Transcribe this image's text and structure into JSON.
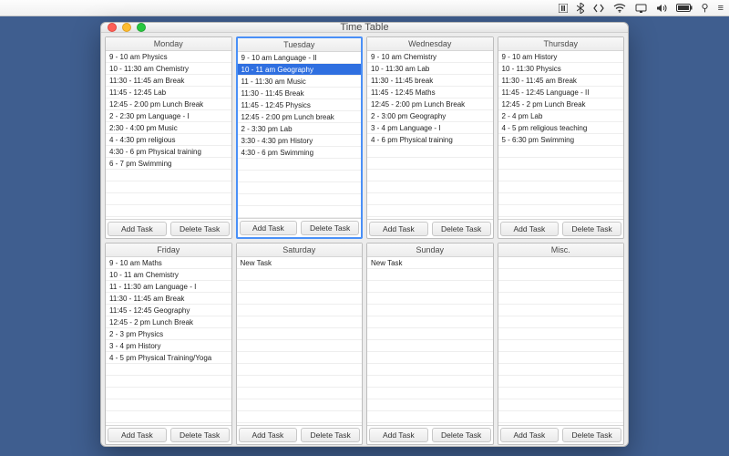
{
  "menubar_icons": [
    "pause",
    "bluetooth",
    "code",
    "wifi",
    "display",
    "volume",
    "battery",
    "search",
    "menu"
  ],
  "window_title": "Time Table",
  "buttons": {
    "add": "Add Task",
    "delete": "Delete Task"
  },
  "selected_panel": 1,
  "selected_row": {
    "panel": 1,
    "index": 1
  },
  "panels": [
    {
      "title": "Monday",
      "items": [
        "9 - 10 am Physics",
        "10 - 11:30 am Chemistry",
        "11:30 - 11:45 am Break",
        "11:45 - 12:45 Lab",
        "12:45 - 2:00 pm Lunch Break",
        "2 - 2:30 pm Language - I",
        "2:30 - 4:00 pm Music",
        "4 - 4:30 pm religious",
        "4:30 - 6 pm Physical training",
        "6 - 7 pm Swimming"
      ]
    },
    {
      "title": "Tuesday",
      "items": [
        "9 - 10 am Language - II",
        "10 - 11 am Geography",
        "11 - 11:30 am Music",
        "11:30 - 11:45 Break",
        "11:45 - 12:45 Physics",
        "12:45 - 2:00 pm Lunch break",
        "2 - 3:30 pm Lab",
        "3:30 - 4:30 pm History",
        "4:30 - 6 pm Swimming"
      ]
    },
    {
      "title": "Wednesday",
      "items": [
        "9 - 10 am Chemistry",
        "10 - 11:30 am Lab",
        "11:30 - 11:45 break",
        "11:45 - 12:45 Maths",
        "12:45 - 2:00 pm Lunch Break",
        "2 - 3:00 pm Geography",
        "3 - 4 pm Language - I",
        "4 - 6 pm Physical training"
      ]
    },
    {
      "title": "Thursday",
      "items": [
        "9 - 10 am History",
        "10 - 11:30 Physics",
        "11:30 - 11:45 am Break",
        "11:45 - 12:45 Language - II",
        "12:45 - 2 pm Lunch Break",
        "2 - 4 pm Lab",
        "4 - 5 pm religious teaching",
        "5 - 6:30 pm Swimming"
      ]
    },
    {
      "title": "Friday",
      "items": [
        "9 - 10 am Maths",
        "10 - 11 am Chemistry",
        "11 - 11:30 am Language - I",
        "11:30 - 11:45 am Break",
        "11:45 - 12:45 Geography",
        "12:45 - 2 pm Lunch Break",
        "2 - 3 pm Physics",
        "3 - 4 pm History",
        "4 - 5 pm Physical Training/Yoga"
      ]
    },
    {
      "title": "Saturday",
      "items": [
        "New Task"
      ]
    },
    {
      "title": "Sunday",
      "items": [
        "New Task"
      ]
    },
    {
      "title": "Misc.",
      "items": []
    }
  ]
}
